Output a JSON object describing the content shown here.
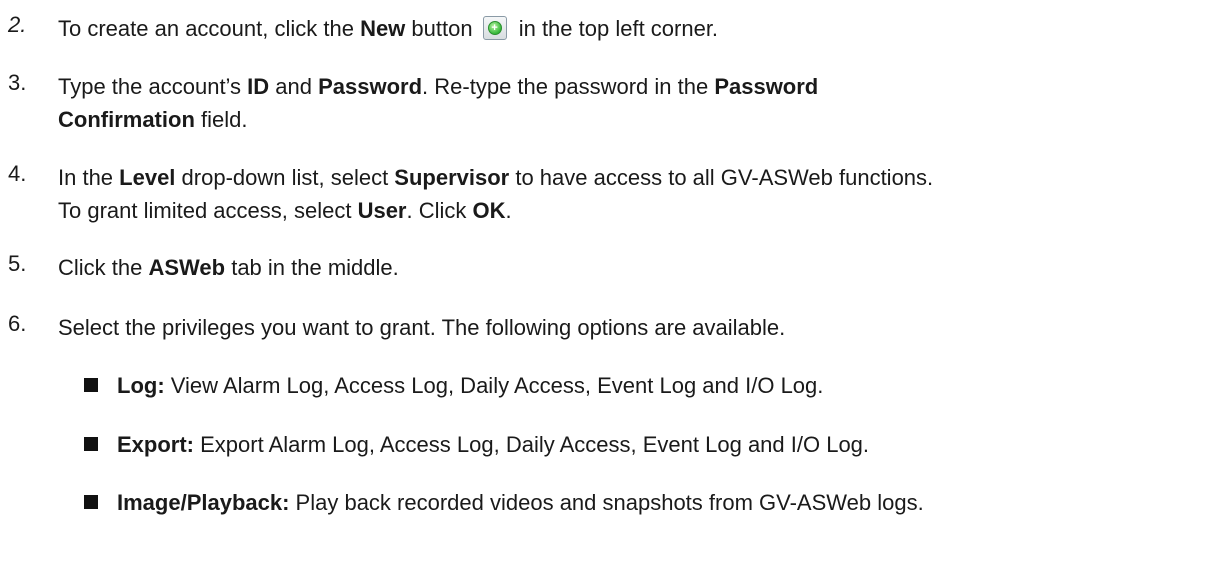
{
  "steps": [
    {
      "number": "2.",
      "parts": [
        "To create an account, click the ",
        "New",
        " button",
        " in the top left corner."
      ],
      "icon": "new-plus-icon"
    },
    {
      "number": "3.",
      "line1": [
        "Type the account’s ",
        "ID",
        " and ",
        "Password",
        ". Re-type the password in the ",
        "Password"
      ],
      "line2": [
        "Confirmation",
        " field."
      ]
    },
    {
      "number": "4.",
      "line1": [
        "In the ",
        "Level",
        " drop-down list, select ",
        "Supervisor",
        " to have access to all GV-ASWeb functions."
      ],
      "line2": [
        "To grant limited access, select ",
        "User",
        ". Click ",
        "OK",
        "."
      ]
    },
    {
      "number": "5.",
      "parts": [
        "Click the ",
        "ASWeb",
        " tab in the middle."
      ]
    },
    {
      "number": "6.",
      "text": "Select the privileges you want to grant. The following options are available."
    }
  ],
  "bullets": [
    {
      "term": "Log:",
      "desc": " View Alarm Log, Access Log, Daily Access, Event Log and I/O Log."
    },
    {
      "term": "Export:",
      "desc": " Export Alarm Log, Access Log, Daily Access, Event Log and I/O Log."
    },
    {
      "term": "Image/Playback:",
      "desc": " Play back recorded videos and snapshots from GV-ASWeb logs."
    }
  ]
}
